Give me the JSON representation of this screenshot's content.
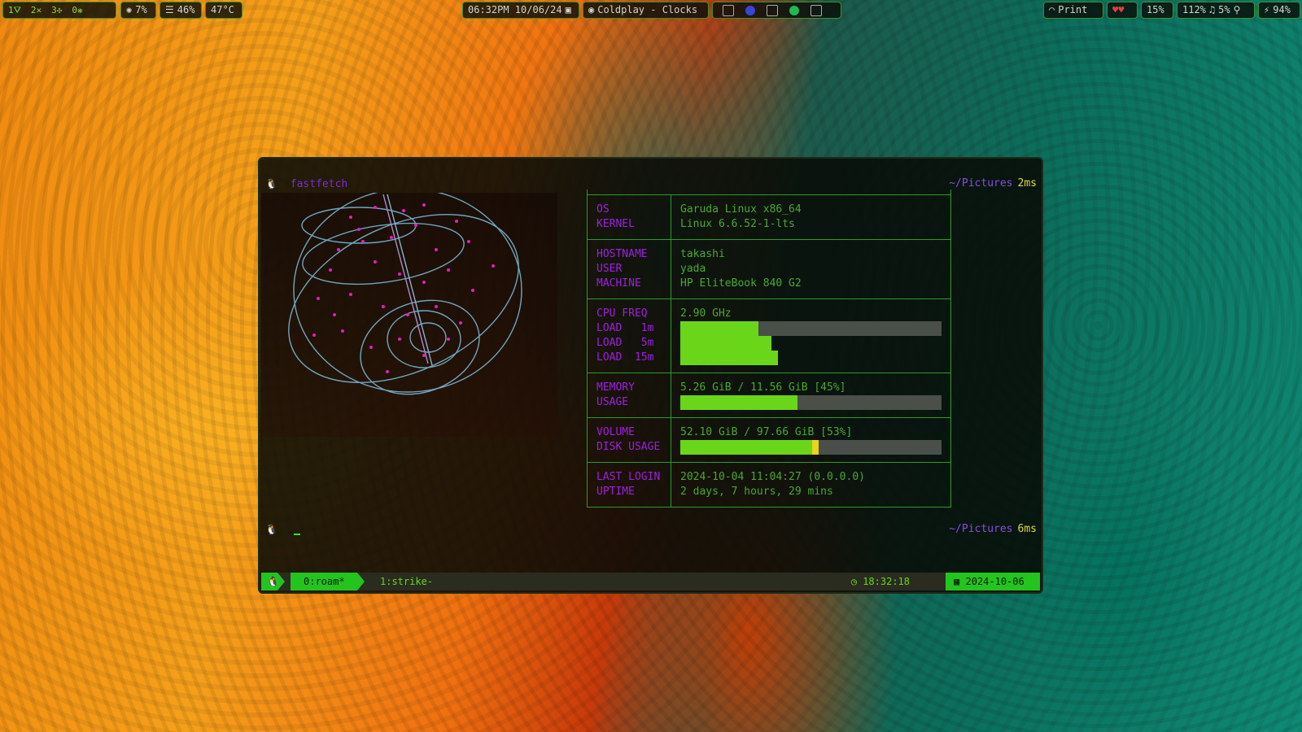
{
  "topbar": {
    "workspaces": [
      {
        "label": "1⛛",
        "active": true
      },
      {
        "label": "2✕",
        "active": false
      },
      {
        "label": "3✣",
        "active": false
      },
      {
        "label": "0❋",
        "active": false
      }
    ],
    "cpu": "7%",
    "mem": "46%",
    "temp": "47°C",
    "clock": "06:32PM 10/06/24",
    "media": "Coldplay - Clocks",
    "print": "Print",
    "brightness": "15%",
    "volume": "112%",
    "mic": "5%",
    "battery": "94%"
  },
  "terminal": {
    "prompt1": {
      "command": "fastfetch",
      "path": "~/Pictures",
      "time": "2ms"
    },
    "prompt2": {
      "path": "~/Pictures",
      "time": "6ms"
    },
    "fastfetch": {
      "os_key": "OS",
      "os_val": "Garuda Linux x86_64",
      "kernel_key": "KERNEL",
      "kernel_val": "Linux 6.6.52-1-lts",
      "hostname_key": "HOSTNAME",
      "hostname_val": "takashi",
      "user_key": "USER",
      "user_val": "yada",
      "machine_key": "MACHINE",
      "machine_val": "HP EliteBook 840 G2",
      "cpu_key": "CPU FREQ",
      "cpu_val": "2.90 GHz",
      "load1_key": "LOAD   1m",
      "load5_key": "LOAD   5m",
      "load15_key": "LOAD  15m",
      "load1": 0.3,
      "load5": 0.35,
      "load15": 0.375,
      "mem_key1": "MEMORY",
      "mem_key2": "USAGE",
      "mem_val": "5.26 GiB / 11.56 GiB [45%]",
      "mem_pct": 45,
      "disk_key1": "VOLUME",
      "disk_key2": "DISK USAGE",
      "disk_val": "52.10 GiB / 97.66 GiB [53%]",
      "disk_pct": 53,
      "login_key": "LAST LOGIN",
      "login_val": "2024-10-04 11:04:27 (0.0.0.0)",
      "uptime_key": "UPTIME",
      "uptime_val": "2 days, 7 hours, 29 mins"
    },
    "tmux": {
      "win0": "0:roam*",
      "win1": "1:strike-",
      "time": "18:32:18",
      "date": "2024-10-06"
    }
  },
  "colors": {
    "accent_green": "#24c41e",
    "key_purple": "#a01fe0",
    "value_green": "#4aa832"
  }
}
